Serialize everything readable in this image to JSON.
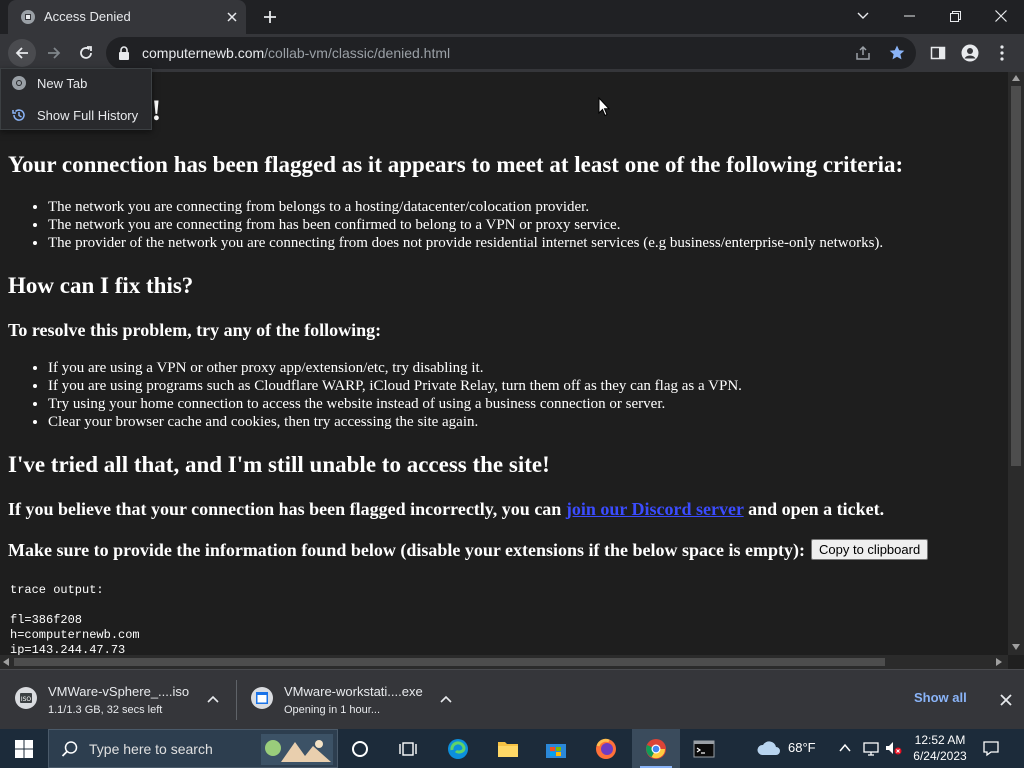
{
  "browser": {
    "tab_title": "Access Denied",
    "url_host": "computernewb.com",
    "url_path": "/collab-vm/classic/denied.html"
  },
  "history_menu": {
    "items": [
      {
        "label": "New Tab",
        "icon": "chrome-icon"
      },
      {
        "label": "Show Full History",
        "icon": "history-icon"
      }
    ]
  },
  "page": {
    "heading_partial": "e!",
    "criteria_heading": "Your connection has been flagged as it appears to meet at least one of the following criteria:",
    "criteria": [
      "The network you are connecting from belongs to a hosting/datacenter/colocation provider.",
      "The network you are connecting from has been confirmed to belong to a VPN or proxy service.",
      "The provider of the network you are connecting from does not provide residential internet services (e.g business/enterprise-only networks)."
    ],
    "fix_heading": "How can I fix this?",
    "resolve_heading": "To resolve this problem, try any of the following:",
    "fixes": [
      "If you are using a VPN or other proxy app/extension/etc, try disabling it.",
      "If you are using programs such as Cloudflare WARP, iCloud Private Relay, turn them off as they can flag as a VPN.",
      "Try using your home connection to access the website instead of using a business connection or server.",
      "Clear your browser cache and cookies, then try accessing the site again."
    ],
    "still_heading": "I've tried all that, and I'm still unable to access the site!",
    "flagged_prefix": "If you believe that your connection has been flagged incorrectly, you can ",
    "discord_link": "join our Discord server",
    "flagged_suffix": " and open a ticket.",
    "provide_info": "Make sure to provide the information found below (disable your extensions if the below space is empty):",
    "copy_button": "Copy to clipboard",
    "trace_output": "trace output:\n\nfl=386f208\nh=computernewb.com\nip=143.244.47.73"
  },
  "downloads": [
    {
      "name": "VMWare-vSphere_....iso",
      "status": "1.1/1.3 GB, 32 secs left"
    },
    {
      "name": "VMware-workstati....exe",
      "status": "Opening in 1 hour..."
    }
  ],
  "shelf": {
    "show_all": "Show all"
  },
  "taskbar": {
    "search_placeholder": "Type here to search",
    "weather": "68°F",
    "time": "12:52 AM",
    "date": "6/24/2023"
  },
  "colors": {
    "accent": "#8ab4f8",
    "link": "#3b4cff",
    "bookmark_star": "#8ab4f8"
  }
}
